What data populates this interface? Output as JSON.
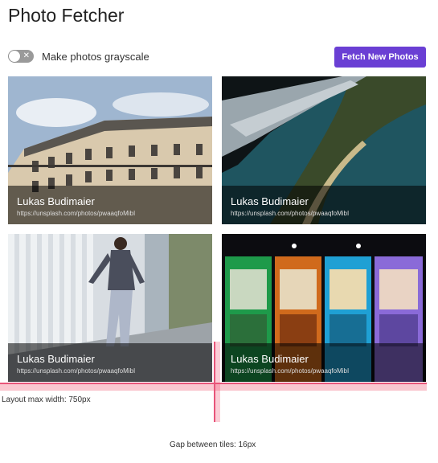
{
  "header": {
    "title": "Photo Fetcher"
  },
  "controls": {
    "toggle_label": "Make photos grayscale",
    "fetch_button": "Fetch New Photos"
  },
  "tiles": [
    {
      "author": "Lukas Budimaier",
      "url": "https://unsplash.com/photos/pwaaqfoMibI",
      "icon": "building-photo"
    },
    {
      "author": "Lukas Budimaier",
      "url": "https://unsplash.com/photos/pwaaqfoMibI",
      "icon": "aerial-coast-photo"
    },
    {
      "author": "Lukas Budimaier",
      "url": "https://unsplash.com/photos/pwaaqfoMibI",
      "icon": "dancer-photo"
    },
    {
      "author": "Lukas Budimaier",
      "url": "https://unsplash.com/photos/pwaaqfoMibI",
      "icon": "arcade-machines-photo"
    }
  ],
  "annotations": {
    "max_width": "Layout max width: 750px",
    "gap": "Gap between tiles: 16px"
  },
  "colors": {
    "accent": "#6a3fd4",
    "guide": "#e8557a"
  }
}
